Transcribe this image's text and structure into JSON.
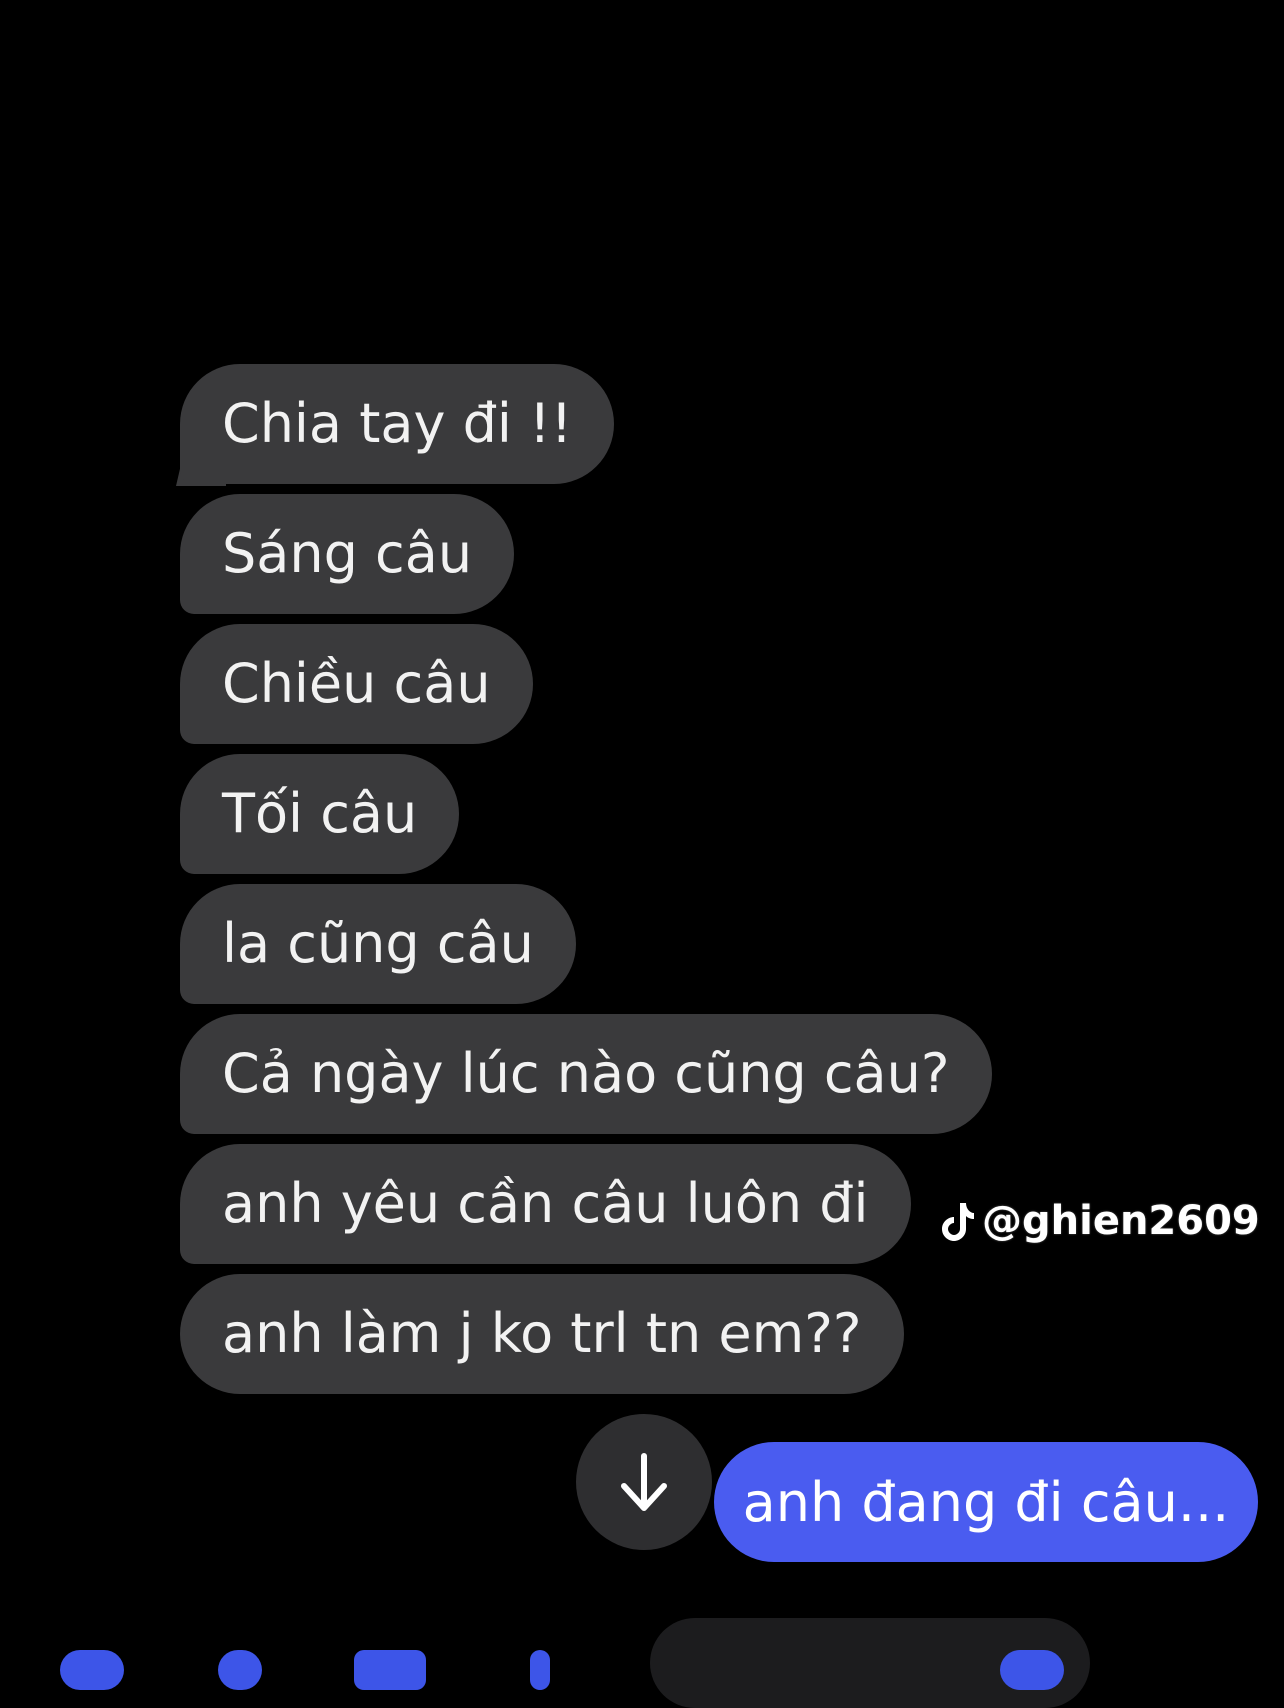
{
  "messages_in": [
    {
      "text": "Chia tay đi !!"
    },
    {
      "text": "Sáng câu"
    },
    {
      "text": "Chiều câu"
    },
    {
      "text": "Tối câu"
    },
    {
      "text": "la cũng câu"
    },
    {
      "text": "Cả ngày lúc nào cũng câu?"
    },
    {
      "text": "anh yêu cần câu luôn đi"
    },
    {
      "text": "anh làm j ko trl tn em??"
    }
  ],
  "message_out": {
    "text": "anh đang đi câu..."
  },
  "scroll_button": {
    "icon": "arrow-down-icon"
  },
  "watermark": {
    "text": "@ghien2609",
    "icon": "tiktok-icon"
  },
  "colors": {
    "background": "#000000",
    "incoming_bubble": "#3a3a3c",
    "outgoing_bubble": "#4a5cf0",
    "text": "#f2f2f2"
  }
}
